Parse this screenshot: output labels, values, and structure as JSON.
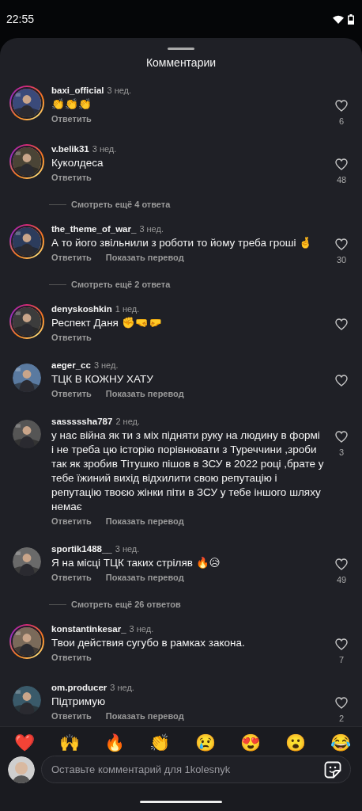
{
  "status_bar": {
    "time": "22:55"
  },
  "sheet": {
    "title": "Комментарии"
  },
  "comments": [
    {
      "username": "baxi_official",
      "age": "3 нед.",
      "text": "👏👏👏",
      "story_ring": true,
      "actions": [
        "Ответить"
      ],
      "likes": "6"
    },
    {
      "username": "v.belik31",
      "age": "3 нед.",
      "text": "Куколдеса",
      "story_ring": true,
      "actions": [
        "Ответить"
      ],
      "likes": "48",
      "more_replies": "Смотреть ещё 4 ответа"
    },
    {
      "username": "the_theme_of_war_",
      "age": "3 нед.",
      "text": "А то його звільнили з роботи то йому треба гроші 🤞",
      "story_ring": true,
      "actions": [
        "Ответить",
        "Показать перевод"
      ],
      "likes": "30",
      "more_replies": "Смотреть ещё 2 ответа"
    },
    {
      "username": "denyskoshkin",
      "age": "1 нед.",
      "text": "Респект Даня ✊🤜🤛",
      "story_ring": true,
      "actions": [
        "Ответить"
      ]
    },
    {
      "username": "aeger_cc",
      "age": "3 нед.",
      "text": "ТЦК В КОЖНУ ХАТУ",
      "story_ring": false,
      "actions": [
        "Ответить",
        "Показать перевод"
      ]
    },
    {
      "username": "sasssssha787",
      "age": "2 нед.",
      "text": "у нас війна як ти з міх підняти руку на людину в формі і не треба цю історію порівнювати з Туреччини ,зроби так як зробив Тітушко пішов в ЗСУ в 2022 році ,брате у тебе їжиний вихід відхилити свою репутацію і репутацію  твоєю жінки піти в ЗСУ у тебе іншого шляху немає",
      "story_ring": false,
      "actions": [
        "Ответить",
        "Показать перевод"
      ],
      "likes": "3"
    },
    {
      "username": "sportik1488__",
      "age": "3 нед.",
      "text": "Я на місці ТЦК таких стріляв 🔥😥",
      "story_ring": false,
      "actions": [
        "Ответить",
        "Показать перевод"
      ],
      "likes": "49",
      "more_replies": "Смотреть ещё 26 ответов"
    },
    {
      "username": "konstantinkesar_",
      "age": "3 нед.",
      "text": "Твои действия сугубо в рамках закона.",
      "story_ring": true,
      "actions": [
        "Ответить"
      ],
      "likes": "7"
    },
    {
      "username": "om.producer",
      "age": "3 нед.",
      "text": "Підтримую",
      "story_ring": false,
      "actions": [
        "Ответить",
        "Показать перевод"
      ],
      "likes": "2"
    }
  ],
  "reactions": [
    "❤️",
    "🙌",
    "🔥",
    "👏",
    "😢",
    "😍",
    "😮",
    "😂"
  ],
  "composer": {
    "placeholder": "Оставьте комментарий для 1kolesnyk"
  }
}
